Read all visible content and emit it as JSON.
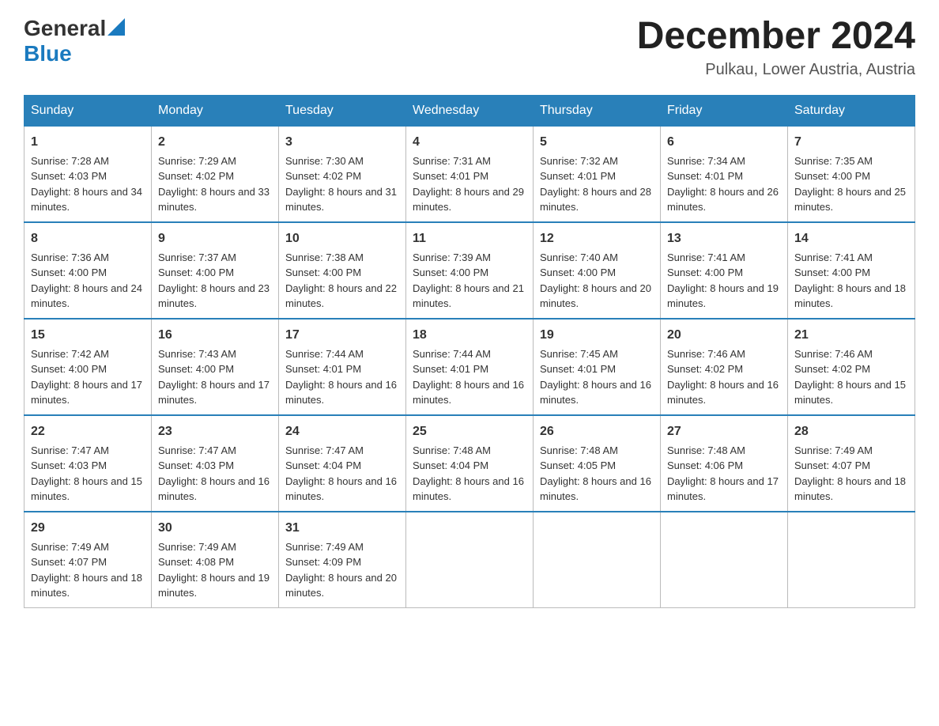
{
  "header": {
    "logo": {
      "general": "General",
      "blue": "Blue",
      "arrow": "▲"
    },
    "title": "December 2024",
    "location": "Pulkau, Lower Austria, Austria"
  },
  "days_of_week": [
    "Sunday",
    "Monday",
    "Tuesday",
    "Wednesday",
    "Thursday",
    "Friday",
    "Saturday"
  ],
  "weeks": [
    [
      {
        "day": "1",
        "sunrise": "7:28 AM",
        "sunset": "4:03 PM",
        "daylight": "8 hours and 34 minutes."
      },
      {
        "day": "2",
        "sunrise": "7:29 AM",
        "sunset": "4:02 PM",
        "daylight": "8 hours and 33 minutes."
      },
      {
        "day": "3",
        "sunrise": "7:30 AM",
        "sunset": "4:02 PM",
        "daylight": "8 hours and 31 minutes."
      },
      {
        "day": "4",
        "sunrise": "7:31 AM",
        "sunset": "4:01 PM",
        "daylight": "8 hours and 29 minutes."
      },
      {
        "day": "5",
        "sunrise": "7:32 AM",
        "sunset": "4:01 PM",
        "daylight": "8 hours and 28 minutes."
      },
      {
        "day": "6",
        "sunrise": "7:34 AM",
        "sunset": "4:01 PM",
        "daylight": "8 hours and 26 minutes."
      },
      {
        "day": "7",
        "sunrise": "7:35 AM",
        "sunset": "4:00 PM",
        "daylight": "8 hours and 25 minutes."
      }
    ],
    [
      {
        "day": "8",
        "sunrise": "7:36 AM",
        "sunset": "4:00 PM",
        "daylight": "8 hours and 24 minutes."
      },
      {
        "day": "9",
        "sunrise": "7:37 AM",
        "sunset": "4:00 PM",
        "daylight": "8 hours and 23 minutes."
      },
      {
        "day": "10",
        "sunrise": "7:38 AM",
        "sunset": "4:00 PM",
        "daylight": "8 hours and 22 minutes."
      },
      {
        "day": "11",
        "sunrise": "7:39 AM",
        "sunset": "4:00 PM",
        "daylight": "8 hours and 21 minutes."
      },
      {
        "day": "12",
        "sunrise": "7:40 AM",
        "sunset": "4:00 PM",
        "daylight": "8 hours and 20 minutes."
      },
      {
        "day": "13",
        "sunrise": "7:41 AM",
        "sunset": "4:00 PM",
        "daylight": "8 hours and 19 minutes."
      },
      {
        "day": "14",
        "sunrise": "7:41 AM",
        "sunset": "4:00 PM",
        "daylight": "8 hours and 18 minutes."
      }
    ],
    [
      {
        "day": "15",
        "sunrise": "7:42 AM",
        "sunset": "4:00 PM",
        "daylight": "8 hours and 17 minutes."
      },
      {
        "day": "16",
        "sunrise": "7:43 AM",
        "sunset": "4:00 PM",
        "daylight": "8 hours and 17 minutes."
      },
      {
        "day": "17",
        "sunrise": "7:44 AM",
        "sunset": "4:01 PM",
        "daylight": "8 hours and 16 minutes."
      },
      {
        "day": "18",
        "sunrise": "7:44 AM",
        "sunset": "4:01 PM",
        "daylight": "8 hours and 16 minutes."
      },
      {
        "day": "19",
        "sunrise": "7:45 AM",
        "sunset": "4:01 PM",
        "daylight": "8 hours and 16 minutes."
      },
      {
        "day": "20",
        "sunrise": "7:46 AM",
        "sunset": "4:02 PM",
        "daylight": "8 hours and 16 minutes."
      },
      {
        "day": "21",
        "sunrise": "7:46 AM",
        "sunset": "4:02 PM",
        "daylight": "8 hours and 15 minutes."
      }
    ],
    [
      {
        "day": "22",
        "sunrise": "7:47 AM",
        "sunset": "4:03 PM",
        "daylight": "8 hours and 15 minutes."
      },
      {
        "day": "23",
        "sunrise": "7:47 AM",
        "sunset": "4:03 PM",
        "daylight": "8 hours and 16 minutes."
      },
      {
        "day": "24",
        "sunrise": "7:47 AM",
        "sunset": "4:04 PM",
        "daylight": "8 hours and 16 minutes."
      },
      {
        "day": "25",
        "sunrise": "7:48 AM",
        "sunset": "4:04 PM",
        "daylight": "8 hours and 16 minutes."
      },
      {
        "day": "26",
        "sunrise": "7:48 AM",
        "sunset": "4:05 PM",
        "daylight": "8 hours and 16 minutes."
      },
      {
        "day": "27",
        "sunrise": "7:48 AM",
        "sunset": "4:06 PM",
        "daylight": "8 hours and 17 minutes."
      },
      {
        "day": "28",
        "sunrise": "7:49 AM",
        "sunset": "4:07 PM",
        "daylight": "8 hours and 18 minutes."
      }
    ],
    [
      {
        "day": "29",
        "sunrise": "7:49 AM",
        "sunset": "4:07 PM",
        "daylight": "8 hours and 18 minutes."
      },
      {
        "day": "30",
        "sunrise": "7:49 AM",
        "sunset": "4:08 PM",
        "daylight": "8 hours and 19 minutes."
      },
      {
        "day": "31",
        "sunrise": "7:49 AM",
        "sunset": "4:09 PM",
        "daylight": "8 hours and 20 minutes."
      },
      null,
      null,
      null,
      null
    ]
  ]
}
